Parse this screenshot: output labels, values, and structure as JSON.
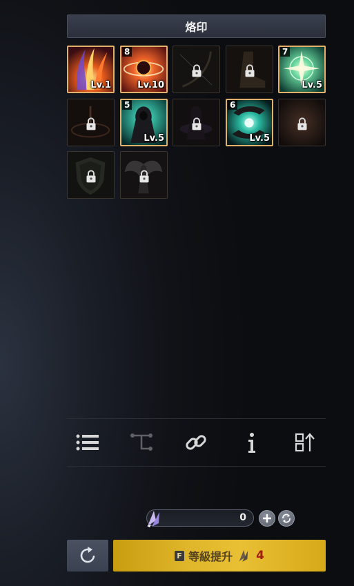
{
  "header": {
    "title": "烙印"
  },
  "slots": [
    {
      "name": "flame-claw",
      "locked": false,
      "badge": "",
      "level": "Lv.1"
    },
    {
      "name": "fire-orb",
      "locked": false,
      "badge": "8",
      "level": "Lv.10"
    },
    {
      "name": "bow",
      "locked": true,
      "badge": "",
      "level": ""
    },
    {
      "name": "boots",
      "locked": true,
      "badge": "",
      "level": ""
    },
    {
      "name": "holy-star",
      "locked": false,
      "badge": "7",
      "level": "Lv.5"
    },
    {
      "name": "fire-circle",
      "locked": true,
      "badge": "",
      "level": ""
    },
    {
      "name": "hooded-warrior",
      "locked": false,
      "badge": "5",
      "level": "Lv.5"
    },
    {
      "name": "shadow-figure",
      "locked": true,
      "badge": "",
      "level": ""
    },
    {
      "name": "spirit-hands",
      "locked": false,
      "badge": "6",
      "level": "Lv.5"
    },
    {
      "name": "red-burst",
      "locked": true,
      "badge": "",
      "level": ""
    },
    {
      "name": "shield",
      "locked": true,
      "badge": "",
      "level": ""
    },
    {
      "name": "winged-angel",
      "locked": true,
      "badge": "",
      "level": ""
    }
  ],
  "toolbar": {
    "items": [
      "list-icon",
      "skill-tree-icon",
      "link-icon",
      "info-icon",
      "sort-icon"
    ]
  },
  "currency": {
    "amount": "0"
  },
  "upgrade": {
    "key": "F",
    "label": "等級提升",
    "cost": "4"
  },
  "colors": {
    "accent": "#e2b26a",
    "button_gold": "#dfb52a",
    "cost_red": "#a31e10"
  }
}
